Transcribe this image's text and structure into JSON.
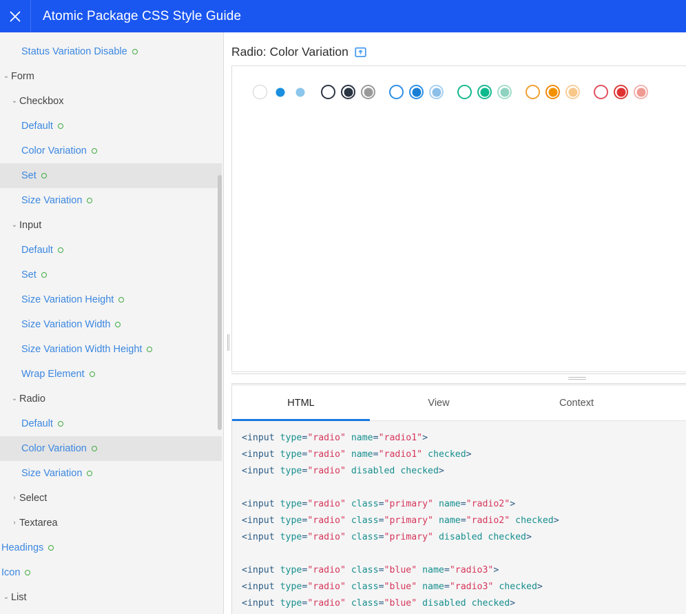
{
  "titlebar": {
    "close_label": "close-icon",
    "title": "Atomic Package CSS Style Guide",
    "bg": "#1a56f0"
  },
  "sidebar": {
    "items": [
      {
        "label": "Status Variation Disable",
        "type": "leaf",
        "indent": 2,
        "selected": false,
        "dot": true
      },
      {
        "label": "Form",
        "type": "group",
        "indent": 0,
        "caret": "down",
        "selected": false,
        "dot": false
      },
      {
        "label": "Checkbox",
        "type": "group",
        "indent": 1,
        "caret": "down",
        "selected": false,
        "dot": false
      },
      {
        "label": "Default",
        "type": "leaf",
        "indent": 2,
        "selected": false,
        "dot": true
      },
      {
        "label": "Color Variation",
        "type": "leaf",
        "indent": 2,
        "selected": false,
        "dot": true
      },
      {
        "label": "Set",
        "type": "leaf",
        "indent": 2,
        "selected": true,
        "dot": true
      },
      {
        "label": "Size Variation",
        "type": "leaf",
        "indent": 2,
        "selected": false,
        "dot": true
      },
      {
        "label": "Input",
        "type": "group",
        "indent": 1,
        "caret": "down",
        "selected": false,
        "dot": false
      },
      {
        "label": "Default",
        "type": "leaf",
        "indent": 2,
        "selected": false,
        "dot": true
      },
      {
        "label": "Set",
        "type": "leaf",
        "indent": 2,
        "selected": false,
        "dot": true
      },
      {
        "label": "Size Variation Height",
        "type": "leaf",
        "indent": 2,
        "selected": false,
        "dot": true
      },
      {
        "label": "Size Variation Width",
        "type": "leaf",
        "indent": 2,
        "selected": false,
        "dot": true
      },
      {
        "label": "Size Variation Width Height",
        "type": "leaf",
        "indent": 2,
        "selected": false,
        "dot": true
      },
      {
        "label": "Wrap Element",
        "type": "leaf",
        "indent": 2,
        "selected": false,
        "dot": true
      },
      {
        "label": "Radio",
        "type": "group",
        "indent": 1,
        "caret": "down",
        "selected": false,
        "dot": false
      },
      {
        "label": "Default",
        "type": "leaf",
        "indent": 2,
        "selected": false,
        "dot": true
      },
      {
        "label": "Color Variation",
        "type": "leaf",
        "indent": 2,
        "selected": true,
        "dot": true
      },
      {
        "label": "Size Variation",
        "type": "leaf",
        "indent": 2,
        "selected": false,
        "dot": true
      },
      {
        "label": "Select",
        "type": "group",
        "indent": 1,
        "caret": "right",
        "selected": false,
        "dot": false
      },
      {
        "label": "Textarea",
        "type": "group",
        "indent": 1,
        "caret": "right",
        "selected": false,
        "dot": false
      },
      {
        "label": "Headings",
        "type": "leaf",
        "indent": 0,
        "selected": false,
        "dot": true
      },
      {
        "label": "Icon",
        "type": "leaf",
        "indent": 0,
        "selected": false,
        "dot": true
      },
      {
        "label": "List",
        "type": "group",
        "indent": 0,
        "caret": "down",
        "selected": false,
        "dot": false
      }
    ],
    "caret_down_glyph": "⌄",
    "caret_right_glyph": "›",
    "link_color": "#3b87e0",
    "group_color": "#444444",
    "dot_color": "#3faa3f",
    "selected_bg": "#e4e4e4"
  },
  "main": {
    "section_title": "Radio: Color Variation",
    "popout_icon": "open-in-new-icon",
    "radios": [
      {
        "name": "default-unchecked",
        "border": "#d0d0d0",
        "fill": "none",
        "dot": 0,
        "state": "unchecked"
      },
      {
        "name": "default-checked",
        "border": "#ffffff",
        "fill": "#1a8fe0",
        "dot": 13,
        "state": "checked"
      },
      {
        "name": "default-disabled",
        "border": "#ffffff",
        "fill": "#8cc6ec",
        "dot": 13,
        "state": "disabled-checked"
      },
      {
        "name": "dark-unchecked",
        "border": "#2a3442",
        "fill": "none",
        "dot": 0,
        "state": "unchecked"
      },
      {
        "name": "dark-checked",
        "border": "#2a3442",
        "fill": "#2a3442",
        "dot": 13,
        "state": "checked"
      },
      {
        "name": "dark-disabled",
        "border": "#9a9a9a",
        "fill": "#9a9a9a",
        "dot": 13,
        "state": "disabled-checked"
      },
      {
        "name": "blue-unchecked",
        "border": "#2d8fe5",
        "fill": "none",
        "dot": 0,
        "state": "unchecked"
      },
      {
        "name": "blue-checked",
        "border": "#2d8fe5",
        "fill": "#1a7fd4",
        "dot": 13,
        "state": "checked"
      },
      {
        "name": "blue-disabled",
        "border": "#a8cfee",
        "fill": "#8cc0e8",
        "dot": 13,
        "state": "disabled-checked"
      },
      {
        "name": "green-unchecked",
        "border": "#17b890",
        "fill": "none",
        "dot": 0,
        "state": "unchecked"
      },
      {
        "name": "green-checked",
        "border": "#17b890",
        "fill": "#0eb98c",
        "dot": 13,
        "state": "checked"
      },
      {
        "name": "green-disabled",
        "border": "#a4ddcd",
        "fill": "#8ed3bf",
        "dot": 13,
        "state": "disabled-checked"
      },
      {
        "name": "orange-unchecked",
        "border": "#f0a030",
        "fill": "none",
        "dot": 0,
        "state": "unchecked"
      },
      {
        "name": "orange-checked",
        "border": "#ee8a0d",
        "fill": "#f29100",
        "dot": 13,
        "state": "checked"
      },
      {
        "name": "orange-disabled",
        "border": "#f6cf9e",
        "fill": "#f8c78a",
        "dot": 13,
        "state": "disabled-checked"
      },
      {
        "name": "red-unchecked",
        "border": "#e05060",
        "fill": "none",
        "dot": 0,
        "state": "unchecked"
      },
      {
        "name": "red-checked",
        "border": "#dc3b3b",
        "fill": "#e03131",
        "dot": 13,
        "state": "checked"
      },
      {
        "name": "red-disabled",
        "border": "#f0b3ae",
        "fill": "#ef9a92",
        "dot": 13,
        "state": "disabled-checked"
      }
    ],
    "tabs": [
      {
        "label": "HTML",
        "active": true
      },
      {
        "label": "View",
        "active": false
      },
      {
        "label": "Context",
        "active": false
      }
    ],
    "code_lines": [
      {
        "tokens": [
          [
            "punc",
            "<"
          ],
          [
            "tag",
            "input"
          ],
          [
            "sp",
            " "
          ],
          [
            "attr",
            "type"
          ],
          [
            "eq",
            "="
          ],
          [
            "str",
            "\"radio\""
          ],
          [
            "sp",
            " "
          ],
          [
            "attr",
            "name"
          ],
          [
            "eq",
            "="
          ],
          [
            "str",
            "\"radio1\""
          ],
          [
            "punc",
            ">"
          ]
        ]
      },
      {
        "tokens": [
          [
            "punc",
            "<"
          ],
          [
            "tag",
            "input"
          ],
          [
            "sp",
            " "
          ],
          [
            "attr",
            "type"
          ],
          [
            "eq",
            "="
          ],
          [
            "str",
            "\"radio\""
          ],
          [
            "sp",
            " "
          ],
          [
            "attr",
            "name"
          ],
          [
            "eq",
            "="
          ],
          [
            "str",
            "\"radio1\""
          ],
          [
            "sp",
            " "
          ],
          [
            "attr",
            "checked"
          ],
          [
            "punc",
            ">"
          ]
        ]
      },
      {
        "tokens": [
          [
            "punc",
            "<"
          ],
          [
            "tag",
            "input"
          ],
          [
            "sp",
            " "
          ],
          [
            "attr",
            "type"
          ],
          [
            "eq",
            "="
          ],
          [
            "str",
            "\"radio\""
          ],
          [
            "sp",
            " "
          ],
          [
            "attr",
            "disabled"
          ],
          [
            "sp",
            " "
          ],
          [
            "attr",
            "checked"
          ],
          [
            "punc",
            ">"
          ]
        ]
      },
      {
        "blank": true
      },
      {
        "tokens": [
          [
            "punc",
            "<"
          ],
          [
            "tag",
            "input"
          ],
          [
            "sp",
            " "
          ],
          [
            "attr",
            "type"
          ],
          [
            "eq",
            "="
          ],
          [
            "str",
            "\"radio\""
          ],
          [
            "sp",
            " "
          ],
          [
            "attr",
            "class"
          ],
          [
            "eq",
            "="
          ],
          [
            "str",
            "\"primary\""
          ],
          [
            "sp",
            " "
          ],
          [
            "attr",
            "name"
          ],
          [
            "eq",
            "="
          ],
          [
            "str",
            "\"radio2\""
          ],
          [
            "punc",
            ">"
          ]
        ]
      },
      {
        "tokens": [
          [
            "punc",
            "<"
          ],
          [
            "tag",
            "input"
          ],
          [
            "sp",
            " "
          ],
          [
            "attr",
            "type"
          ],
          [
            "eq",
            "="
          ],
          [
            "str",
            "\"radio\""
          ],
          [
            "sp",
            " "
          ],
          [
            "attr",
            "class"
          ],
          [
            "eq",
            "="
          ],
          [
            "str",
            "\"primary\""
          ],
          [
            "sp",
            " "
          ],
          [
            "attr",
            "name"
          ],
          [
            "eq",
            "="
          ],
          [
            "str",
            "\"radio2\""
          ],
          [
            "sp",
            " "
          ],
          [
            "attr",
            "checked"
          ],
          [
            "punc",
            ">"
          ]
        ]
      },
      {
        "tokens": [
          [
            "punc",
            "<"
          ],
          [
            "tag",
            "input"
          ],
          [
            "sp",
            " "
          ],
          [
            "attr",
            "type"
          ],
          [
            "eq",
            "="
          ],
          [
            "str",
            "\"radio\""
          ],
          [
            "sp",
            " "
          ],
          [
            "attr",
            "class"
          ],
          [
            "eq",
            "="
          ],
          [
            "str",
            "\"primary\""
          ],
          [
            "sp",
            " "
          ],
          [
            "attr",
            "disabled"
          ],
          [
            "sp",
            " "
          ],
          [
            "attr",
            "checked"
          ],
          [
            "punc",
            ">"
          ]
        ]
      },
      {
        "blank": true
      },
      {
        "tokens": [
          [
            "punc",
            "<"
          ],
          [
            "tag",
            "input"
          ],
          [
            "sp",
            " "
          ],
          [
            "attr",
            "type"
          ],
          [
            "eq",
            "="
          ],
          [
            "str",
            "\"radio\""
          ],
          [
            "sp",
            " "
          ],
          [
            "attr",
            "class"
          ],
          [
            "eq",
            "="
          ],
          [
            "str",
            "\"blue\""
          ],
          [
            "sp",
            " "
          ],
          [
            "attr",
            "name"
          ],
          [
            "eq",
            "="
          ],
          [
            "str",
            "\"radio3\""
          ],
          [
            "punc",
            ">"
          ]
        ]
      },
      {
        "tokens": [
          [
            "punc",
            "<"
          ],
          [
            "tag",
            "input"
          ],
          [
            "sp",
            " "
          ],
          [
            "attr",
            "type"
          ],
          [
            "eq",
            "="
          ],
          [
            "str",
            "\"radio\""
          ],
          [
            "sp",
            " "
          ],
          [
            "attr",
            "class"
          ],
          [
            "eq",
            "="
          ],
          [
            "str",
            "\"blue\""
          ],
          [
            "sp",
            " "
          ],
          [
            "attr",
            "name"
          ],
          [
            "eq",
            "="
          ],
          [
            "str",
            "\"radio3\""
          ],
          [
            "sp",
            " "
          ],
          [
            "attr",
            "checked"
          ],
          [
            "punc",
            ">"
          ]
        ]
      },
      {
        "tokens": [
          [
            "punc",
            "<"
          ],
          [
            "tag",
            "input"
          ],
          [
            "sp",
            " "
          ],
          [
            "attr",
            "type"
          ],
          [
            "eq",
            "="
          ],
          [
            "str",
            "\"radio\""
          ],
          [
            "sp",
            " "
          ],
          [
            "attr",
            "class"
          ],
          [
            "eq",
            "="
          ],
          [
            "str",
            "\"blue\""
          ],
          [
            "sp",
            " "
          ],
          [
            "attr",
            "disabled"
          ],
          [
            "sp",
            " "
          ],
          [
            "attr",
            "checked"
          ],
          [
            "punc",
            ">"
          ]
        ]
      }
    ]
  }
}
